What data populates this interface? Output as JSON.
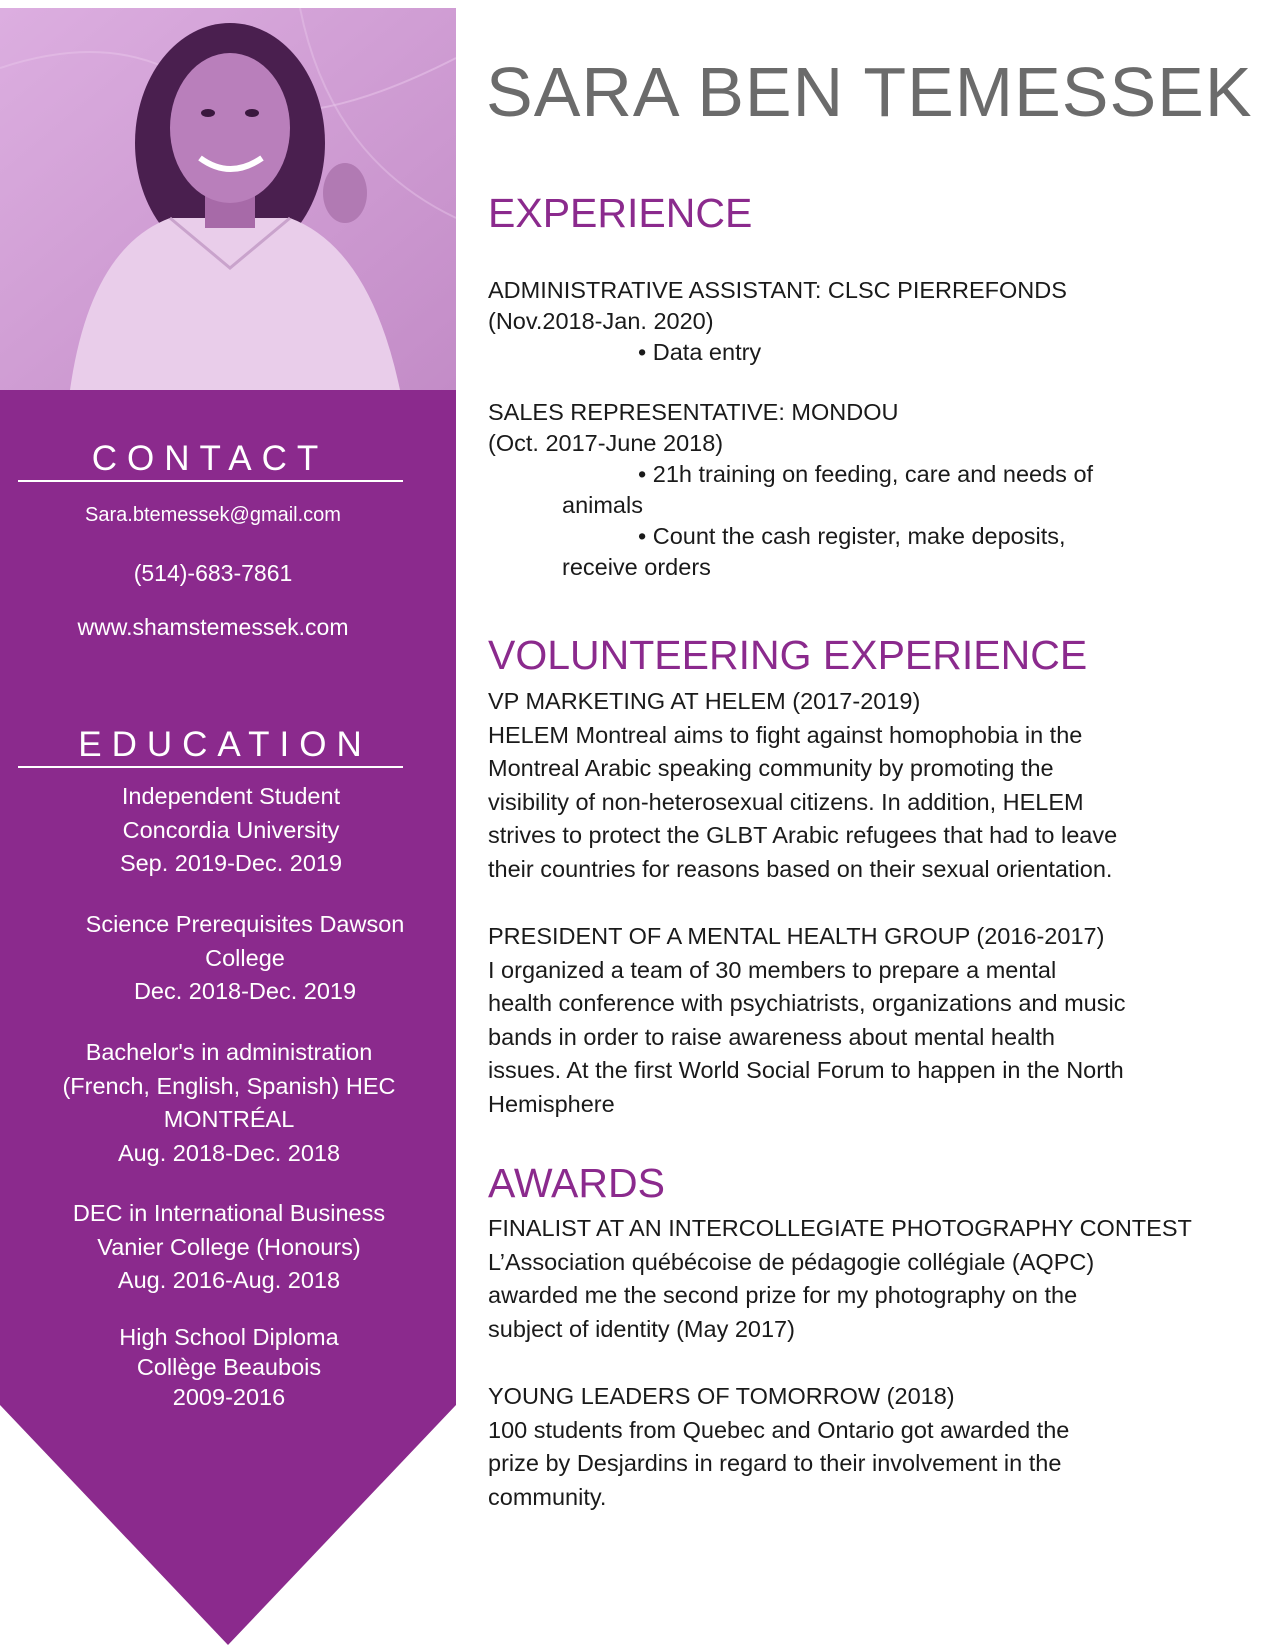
{
  "name": "SARA BEN TEMESSEK",
  "colors": {
    "accent": "#8b2a8d",
    "name_gray": "#6b6b6b",
    "photo_tint": "#c98fcb"
  },
  "photo": {
    "alt": "portrait-photo"
  },
  "contact": {
    "heading": "CONTACT",
    "email": "Sara.btemessek@gmail.com",
    "phone": "(514)-683-7861",
    "website": "www.shamstemessek.com"
  },
  "education": {
    "heading": "EDUCATION",
    "entries": [
      {
        "lines": [
          "Independent Student",
          "Concordia University",
          "Sep. 2019-Dec. 2019"
        ]
      },
      {
        "lines": [
          "Science Prerequisites Dawson",
          "College",
          "Dec. 2018-Dec. 2019"
        ]
      },
      {
        "lines": [
          "Bachelor's in administration",
          "(French, English, Spanish)  HEC",
          "MONTRÉAL",
          "Aug. 2018-Dec. 2018"
        ]
      },
      {
        "lines": [
          "DEC in International Business",
          "Vanier College (Honours)",
          "Aug. 2016-Aug. 2018"
        ]
      },
      {
        "lines": [
          "High School Diploma",
          "Collège Beaubois",
          "2009-2016"
        ]
      }
    ]
  },
  "experience": {
    "heading": "EXPERIENCE",
    "jobs": [
      {
        "title": "ADMINISTRATIVE ASSISTANT: CLSC PIERREFONDS",
        "dates": "(Nov.2018-Jan. 2020)",
        "bullets": [
          {
            "first": "• Data entry",
            "rest": ""
          }
        ]
      },
      {
        "title": "SALES REPRESENTATIVE: MONDOU",
        "dates": "(Oct. 2017-June 2018)",
        "bullets": [
          {
            "first": "• 21h training on feeding, care and needs of",
            "rest": "animals"
          },
          {
            "first": "• Count the cash register, make deposits,",
            "rest": "receive orders"
          }
        ]
      }
    ]
  },
  "volunteering": {
    "heading": "VOLUNTEERING EXPERIENCE",
    "items": [
      {
        "title": "VP MARKETING AT HELEM (2017-2019)",
        "lines": [
          "HELEM Montreal aims to fight against homophobia in the",
          "Montreal Arabic speaking community by promoting the",
          "visibility of non-heterosexual citizens. In addition, HELEM",
          "strives to protect the GLBT Arabic refugees that had to leave",
          "their countries for reasons based on their sexual orientation."
        ]
      },
      {
        "title": "PRESIDENT OF A MENTAL HEALTH GROUP (2016-2017)",
        "lines": [
          "I organized a team of 30 members to prepare a mental",
          "health conference with psychiatrists, organizations and music",
          "bands in order to raise awareness about mental health",
          "issues. At the first World Social Forum to happen in the North",
          "Hemisphere"
        ]
      }
    ]
  },
  "awards": {
    "heading": "AWARDS",
    "items": [
      {
        "title": "FINALIST AT AN INTERCOLLEGIATE PHOTOGRAPHY CONTEST",
        "lines": [
          "L’Association québécoise de pédagogie collégiale (AQPC)",
          "awarded me the second prize for my photography on the",
          "subject of identity (May 2017)"
        ]
      },
      {
        "title": "YOUNG LEADERS OF TOMORROW (2018)",
        "lines": [
          "100 students from Quebec and Ontario got awarded the",
          "prize by Desjardins in regard to their involvement in the",
          "community."
        ]
      }
    ]
  }
}
